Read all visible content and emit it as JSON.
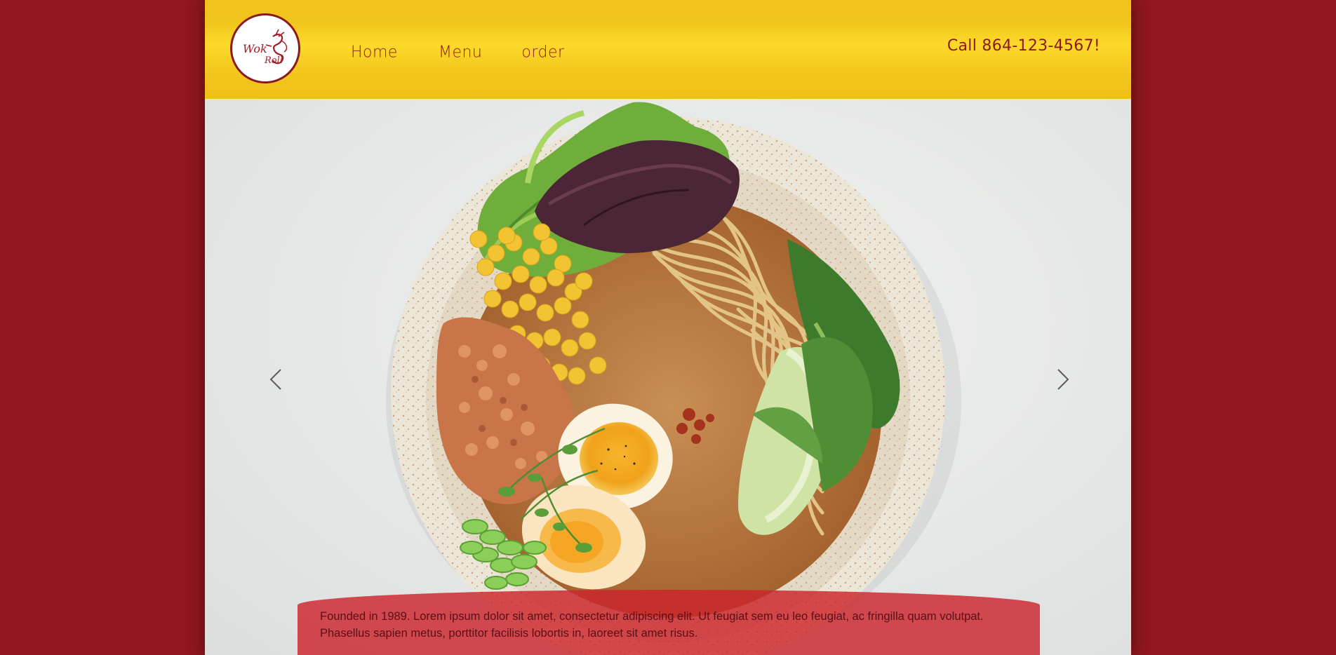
{
  "logo": {
    "text_line1": "Wok",
    "text_line2": "Roll",
    "icon": "dragon-logo-icon"
  },
  "nav": {
    "items": [
      {
        "label": "Home"
      },
      {
        "label": "Menu"
      },
      {
        "label": "order"
      }
    ]
  },
  "header": {
    "phone": "Call 864-123-4567!"
  },
  "hero": {
    "image": "ramen-bowl-image",
    "prev_icon": "chevron-left-icon",
    "next_icon": "chevron-right-icon",
    "caption_line1": "Founded in 1989. Lorem ipsum dolor sit amet, consectetur adipiscing elit. Ut feugiat sem eu leo feugiat, ac fringilla quam volutpat.",
    "caption_line2": "Phasellus sapien metus, porttitor facilisis lobortis in, laoreet sit amet risus."
  },
  "colors": {
    "brand_red": "#8f171e",
    "header_yellow": "#fdd92a",
    "caption_red": "#cc242c"
  }
}
